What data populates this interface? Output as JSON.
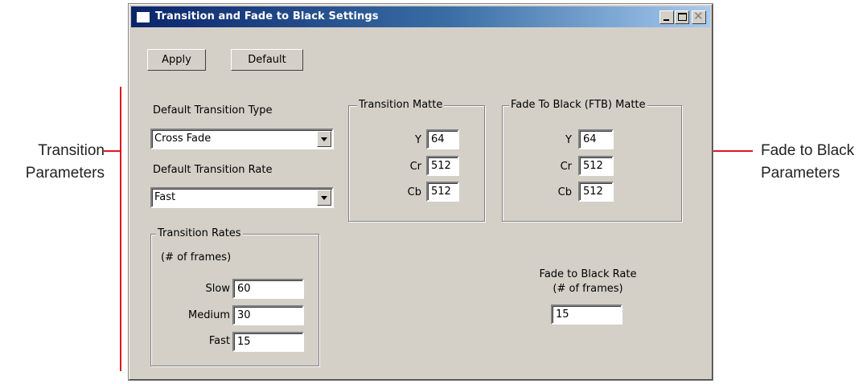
{
  "window": {
    "title": "Transition and Fade to Black Settings",
    "close_glyph": "✕"
  },
  "toolbar": {
    "apply_label": "Apply",
    "default_label": "Default"
  },
  "transition": {
    "type_label": "Default Transition Type",
    "type_value": "Cross Fade",
    "rate_label": "Default Transition Rate",
    "rate_value": "Fast"
  },
  "transition_matte": {
    "title": "Transition Matte",
    "y_label": "Y",
    "y": "64",
    "cr_label": "Cr",
    "cr": "512",
    "cb_label": "Cb",
    "cb": "512"
  },
  "ftb_matte": {
    "title": "Fade To Black (FTB) Matte",
    "y_label": "Y",
    "y": "64",
    "cr_label": "Cr",
    "cr": "512",
    "cb_label": "Cb",
    "cb": "512"
  },
  "transition_rates": {
    "title": "Transition Rates",
    "subtitle": "(# of frames)",
    "slow_label": "Slow",
    "slow": "60",
    "medium_label": "Medium",
    "medium": "30",
    "fast_label": "Fast",
    "fast": "15"
  },
  "ftb_rate": {
    "label_line1": "Fade to Black Rate",
    "label_line2": "(# of frames)",
    "value": "15"
  },
  "callouts": {
    "left": [
      "Transition",
      "Parameters"
    ],
    "right": [
      "Fade to Black",
      "Parameters"
    ],
    "line_color": "#e0141e"
  }
}
